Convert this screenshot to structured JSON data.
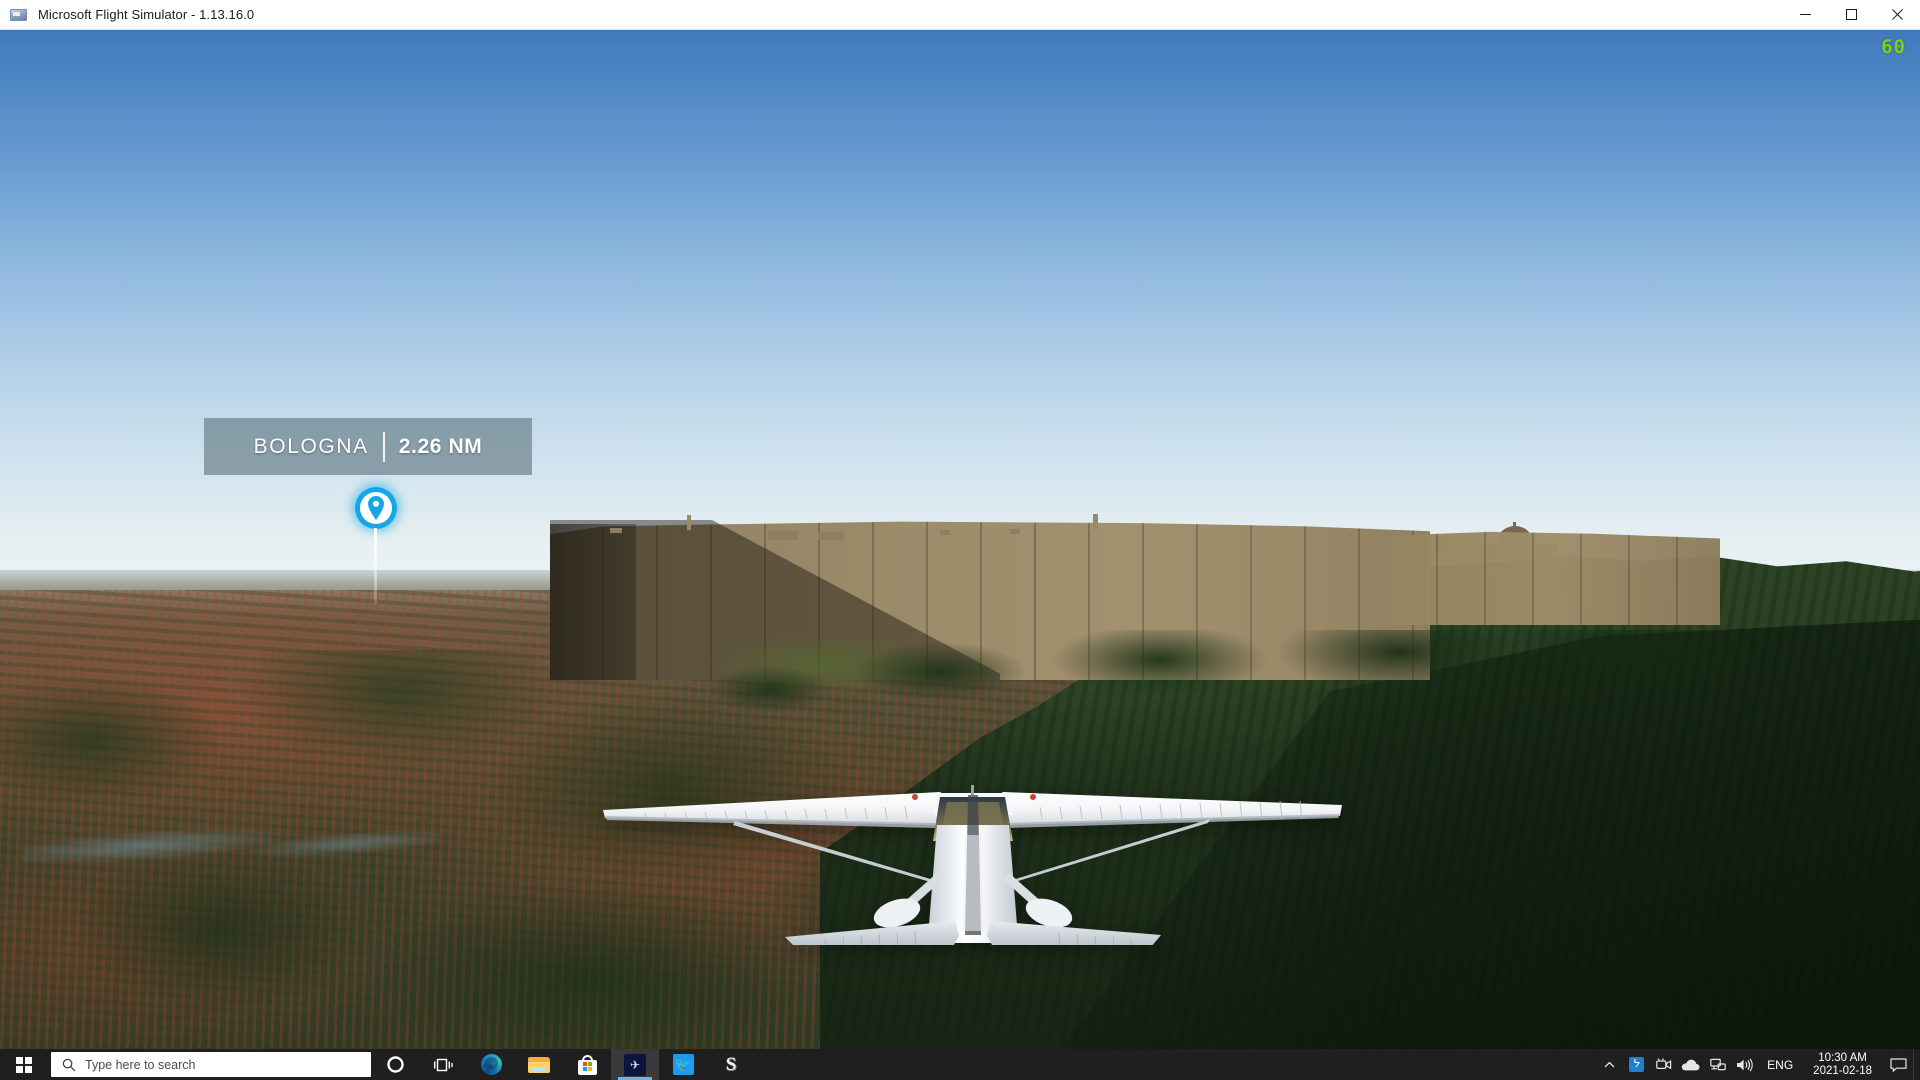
{
  "window": {
    "title": "Microsoft Flight Simulator - 1.13.16.0",
    "app_icon": "flight-simulator-icon",
    "controls": {
      "minimize": "minimize-icon",
      "maximize": "maximize-icon",
      "close": "close-icon"
    }
  },
  "hud": {
    "fps": "60",
    "fps_color": "#86d600",
    "poi": {
      "name": "BOLOGNA",
      "distance": "2.26 NM",
      "pin_icon": "map-pin-icon",
      "accent_color": "#14a7e8",
      "bar_color": "rgba(110,132,142,0.72)"
    }
  },
  "scene": {
    "aircraft": "cessna-172-skyhawk",
    "location": "Bologna, Italy",
    "landmarks": [
      "giant-glitched-skyscraper",
      "san-luca-basilica",
      "bologna-cityscape",
      "forested-hills"
    ],
    "sky_top_color": "#3f79bb",
    "sky_horizon_color": "#eef4f3",
    "terrain_color": "#2a3221",
    "building_color": "#9e8d6b"
  },
  "taskbar": {
    "start": "windows-start-icon",
    "search": {
      "placeholder": "Type here to search",
      "value": "",
      "icon": "search-icon"
    },
    "cortana": "cortana-icon",
    "task_view": "task-view-icon",
    "apps": [
      {
        "name": "microsoft-edge",
        "label": "Microsoft Edge",
        "active": false
      },
      {
        "name": "file-explorer",
        "label": "File Explorer",
        "active": false
      },
      {
        "name": "microsoft-store",
        "label": "Microsoft Store",
        "active": false
      },
      {
        "name": "flight-simulator",
        "label": "Microsoft Flight Simulator",
        "active": true
      },
      {
        "name": "twitter",
        "label": "Twitter",
        "active": false
      },
      {
        "name": "s-app",
        "label": "S",
        "active": false
      }
    ],
    "tray": {
      "show_hidden": "chevron-up-icon",
      "bluetooth": "bluetooth-icon",
      "camera": "camera-icon",
      "onedrive": "onedrive-cloud-icon",
      "network": "network-icon",
      "volume": "volume-icon",
      "language": "ENG",
      "time": "10:30 AM",
      "date": "2021-02-18",
      "action_center": "notifications-icon"
    }
  }
}
